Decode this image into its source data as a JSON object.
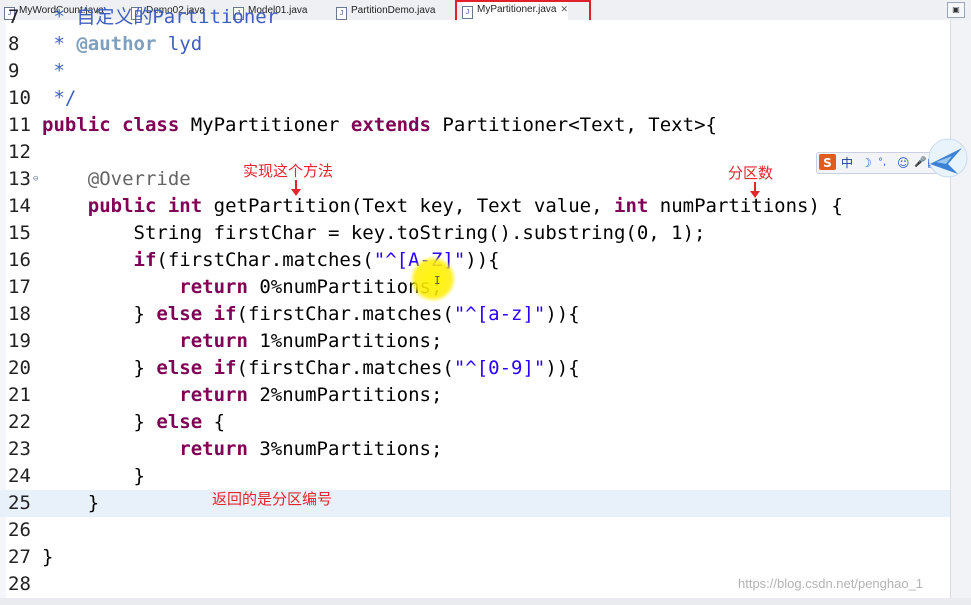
{
  "tabs": [
    {
      "label": "MyWordCount.java",
      "active": false
    },
    {
      "label": "Demo02.java",
      "active": false
    },
    {
      "label": "Model01.java",
      "active": false
    },
    {
      "label": "PartitionDemo.java",
      "active": false
    },
    {
      "label": "MyPartitioner.java",
      "active": true,
      "close": "✕"
    }
  ],
  "window_control": "▣",
  "code_lines": [
    {
      "num": "7",
      "html": "<span class=\"cm\"> * 自定义的Partitioner</span>"
    },
    {
      "num": "8",
      "html": "<span class=\"cm\"> * </span><span class=\"cmtag\">@author</span><span class=\"cm\"> lyd</span>"
    },
    {
      "num": "9",
      "html": "<span class=\"cm\"> *</span>"
    },
    {
      "num": "10",
      "html": "<span class=\"cm\"> */</span>"
    },
    {
      "num": "11",
      "html": "<span class=\"kw\">public</span> <span class=\"kw\">class</span> MyPartitioner <span class=\"kw\">extends</span> Partitioner&lt;Text, Text&gt;{"
    },
    {
      "num": "12",
      "html": ""
    },
    {
      "num": "13",
      "html": "    <span class=\"an\">@Override</span>",
      "fold": "⊖"
    },
    {
      "num": "14",
      "html": "    <span class=\"kw\">public</span> <span class=\"kw\">int</span> getPartition(Text key, Text value, <span class=\"kw\">int</span> numPartitions) {"
    },
    {
      "num": "15",
      "html": "        String firstChar = key.toString().substring(0, 1);"
    },
    {
      "num": "16",
      "html": "        <span class=\"kw\">if</span>(firstChar.matches(<span class=\"str\">\"^[A-Z]\"</span>)){"
    },
    {
      "num": "17",
      "html": "            <span class=\"kw\">return</span> 0%numPartitions;"
    },
    {
      "num": "18",
      "html": "        } <span class=\"kw\">else</span> <span class=\"kw\">if</span>(firstChar.matches(<span class=\"str\">\"^[a-z]\"</span>)){"
    },
    {
      "num": "19",
      "html": "            <span class=\"kw\">return</span> 1%numPartitions;"
    },
    {
      "num": "20",
      "html": "        } <span class=\"kw\">else</span> <span class=\"kw\">if</span>(firstChar.matches(<span class=\"str\">\"^[0-9]\"</span>)){"
    },
    {
      "num": "21",
      "html": "            <span class=\"kw\">return</span> 2%numPartitions;"
    },
    {
      "num": "22",
      "html": "        } <span class=\"kw\">else</span> {"
    },
    {
      "num": "23",
      "html": "            <span class=\"kw\">return</span> 3%numPartitions;"
    },
    {
      "num": "24",
      "html": "        }"
    },
    {
      "num": "25",
      "html": "    }",
      "highlight": true
    },
    {
      "num": "26",
      "html": ""
    },
    {
      "num": "27",
      "html": "}"
    },
    {
      "num": "28",
      "html": ""
    }
  ],
  "annotations": {
    "implement_method": "实现这个方法",
    "partition_count": "分区数",
    "returns_partition_number": "返回的是分区编号"
  },
  "ime_bar": {
    "logo": "S",
    "mode": "中",
    "icons": [
      "☽",
      "°,",
      "☺",
      "🎤",
      "▦",
      "👕"
    ]
  },
  "watermark": "https://blog.csdn.net/penghao_1",
  "colors": {
    "keyword": "#7f0055",
    "string": "#2a00ff",
    "annotation_note": "#e4262c",
    "comment": "#3f5fbf",
    "tab_highlight": "#e0202a"
  }
}
